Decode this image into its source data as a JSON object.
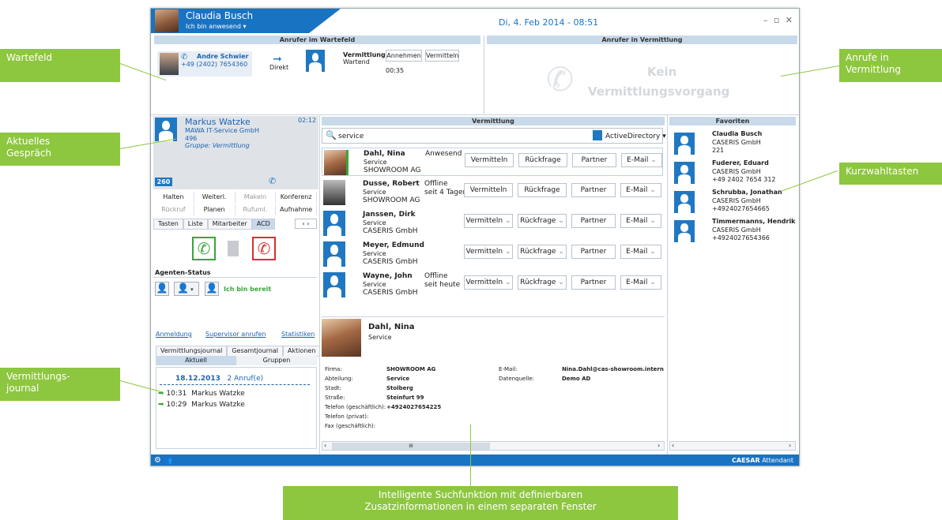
{
  "title": {
    "user_name": "Claudia Busch",
    "user_status": "Ich bin anwesend",
    "datetime": "Di, 4. Feb 2014 - 08:51",
    "window_controls": "– ▫ ✕"
  },
  "queue": {
    "header": "Anrufer im Wartefeld",
    "caller_name": "Andre Schwier",
    "caller_number": "+49 (2402) 7654360",
    "direct_label": "Direkt",
    "target_name": "Vermittlung",
    "target_state": "Wartend",
    "accept_label": "Annehmen",
    "transfer_label": "Vermitteln",
    "timer": "00:35"
  },
  "transfer_area": {
    "header": "Anrufer in Vermittlung",
    "empty_text_1": "Kein",
    "empty_text_2": "Vermittlungsvorgang"
  },
  "current_call": {
    "name": "Markus Watzke",
    "company": "MAWA IT-Service GmbH",
    "number": "496",
    "group": "Gruppe: Vermittlung",
    "duration": "02:12",
    "badge": "260"
  },
  "controls": {
    "row1": [
      "Halten",
      "Weiterl.",
      "Makeln",
      "Konferenz"
    ],
    "row2": [
      "Rückruf",
      "Planen",
      "Rufuml.",
      "Aufnahme"
    ],
    "tabs": [
      "Tasten",
      "Liste",
      "Mitarbeiter",
      "ACD"
    ],
    "agent_status_label": "Agenten-Status",
    "ready_label": "Ich bin bereit"
  },
  "links": {
    "login": "Anmeldung",
    "supervisor": "Supervisor anrufen",
    "stats": "Statistiken"
  },
  "journal": {
    "tabs": [
      "Vermittlungsjournal",
      "Gesamtjournal",
      "Aktionen"
    ],
    "subtabs": [
      "Aktuell",
      "Gruppen"
    ],
    "date": "18.12.2013",
    "count": "2 Anruf(e)",
    "entries": [
      {
        "time": "10:31",
        "name": "Markus Watzke"
      },
      {
        "time": "10:29",
        "name": "Markus Watzke"
      }
    ]
  },
  "search": {
    "header": "Vermittlung",
    "query": "service",
    "source": "ActiveDirectory",
    "results": [
      {
        "name": "Dahl, Nina",
        "dept": "Service",
        "company": "SHOWROOM AG",
        "status": "Anwesend",
        "status2": ""
      },
      {
        "name": "Dusse, Robert",
        "dept": "Service",
        "company": "SHOWROOM AG",
        "status": "Offline",
        "status2": "seit 4 Tagen"
      },
      {
        "name": "Janssen, Dirk",
        "dept": "Service",
        "company": "CASERIS GmbH",
        "status": "",
        "status2": ""
      },
      {
        "name": "Meyer, Edmund",
        "dept": "Service",
        "company": "CASERIS GmbH",
        "status": "",
        "status2": ""
      },
      {
        "name": "Wayne, John",
        "dept": "Service",
        "company": "CASERIS GmbH",
        "status": "Offline",
        "status2": "seit heute"
      }
    ],
    "actions": [
      "Vermitteln",
      "Rückfrage",
      "Partner",
      "E-Mail"
    ]
  },
  "detail": {
    "name": "Dahl, Nina",
    "dept": "Service",
    "fields_left": [
      [
        "Firma:",
        "SHOWROOM AG"
      ],
      [
        "Abteilung:",
        "Service"
      ],
      [
        "Stadt:",
        "Stolberg"
      ],
      [
        "Straße:",
        "Steinfurt 99"
      ],
      [
        "Telefon (geschäftlich):",
        "+4924027654225"
      ],
      [
        "Telefon (privat):",
        ""
      ],
      [
        "Fax (geschäftlich):",
        ""
      ]
    ],
    "fields_right": [
      [
        "E-Mail:",
        "Nina.Dahl@cas-showroom.intern"
      ],
      [
        "Datenquelle:",
        "Demo AD"
      ]
    ],
    "scroll": "III"
  },
  "favorites": {
    "header": "Favoriten",
    "items": [
      {
        "name": "Claudia Busch",
        "company": "CASERIS GmbH",
        "number": "221"
      },
      {
        "name": "Fuderer, Eduard",
        "company": "CASERIS GmbH",
        "number": "+49 2402 7654 312"
      },
      {
        "name": "Schrubba, Jonathan",
        "company": "CASERIS GmbH",
        "number": "+4924027654665"
      },
      {
        "name": "Timmermanns, Hendrik",
        "company": "CASERIS GmbH",
        "number": "+4924027654366"
      }
    ]
  },
  "statusbar": {
    "brand": "CAESAR",
    "product": "Attendant"
  },
  "callouts": {
    "wartefeld": "Wartefeld",
    "anrufe_1": "Anrufe in",
    "anrufe_2": "Vermittlung",
    "aktuelles_1": "Aktuelles",
    "aktuelles_2": "Gespräch",
    "kurzwahl": "Kurzwahltasten",
    "journal_1": "Vermittlungs-",
    "journal_2": "journal",
    "search_1": "Intelligente Suchfunktion mit definierbaren",
    "search_2": "Zusatzinformationen in einem separaten Fenster"
  },
  "colors": {
    "accent": "#1973c3",
    "callout": "#8dc63f",
    "header": "#c8d9ea"
  }
}
